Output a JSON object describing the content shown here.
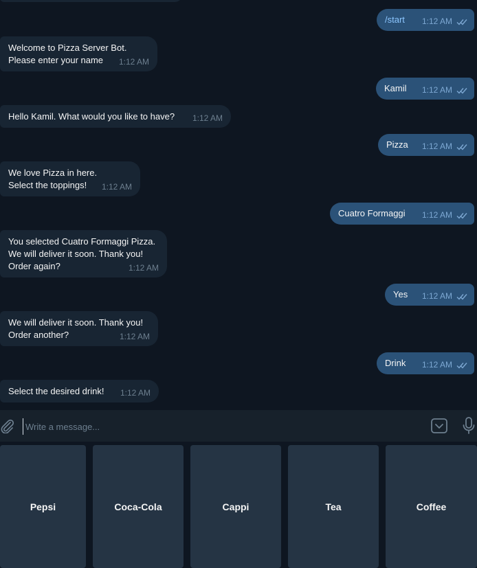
{
  "chat": {
    "messages": [
      {
        "dir": "out",
        "text": "/start",
        "time": "1:12 AM",
        "command": true
      },
      {
        "dir": "in",
        "text": "Welcome to Pizza Server Bot.\nPlease enter your name",
        "time": "1:12 AM"
      },
      {
        "dir": "out",
        "text": "Kamil",
        "time": "1:12 AM"
      },
      {
        "dir": "in",
        "text": "Hello Kamil. What would you like to have?",
        "time": "1:12 AM"
      },
      {
        "dir": "out",
        "text": "Pizza",
        "time": "1:12 AM"
      },
      {
        "dir": "in",
        "text": "We love Pizza in here.\nSelect the toppings!",
        "time": "1:12 AM"
      },
      {
        "dir": "out",
        "text": "Cuatro Formaggi",
        "time": "1:12 AM"
      },
      {
        "dir": "in",
        "text": "You selected Cuatro Formaggi Pizza.\nWe will deliver it soon. Thank you!\nOrder again?",
        "time": "1:12 AM"
      },
      {
        "dir": "out",
        "text": "Yes",
        "time": "1:12 AM"
      },
      {
        "dir": "in",
        "text": "We will deliver it soon. Thank you!\nOrder another?",
        "time": "1:12 AM"
      },
      {
        "dir": "out",
        "text": "Drink",
        "time": "1:12 AM"
      },
      {
        "dir": "in",
        "text": "Select the desired drink!",
        "time": "1:12 AM"
      }
    ]
  },
  "composer": {
    "placeholder": "Write a message...",
    "icons": {
      "attach": "paperclip-icon",
      "keyboard": "keyboard-toggle-icon",
      "mic": "microphone-icon"
    }
  },
  "keyboard": {
    "buttons": [
      "Pepsi",
      "Coca-Cola",
      "Cappi",
      "Tea",
      "Coffee"
    ]
  },
  "colors": {
    "background": "#0e1621",
    "incoming_bubble": "#182533",
    "outgoing_bubble": "#2b5278",
    "keyboard_button": "#253444"
  }
}
